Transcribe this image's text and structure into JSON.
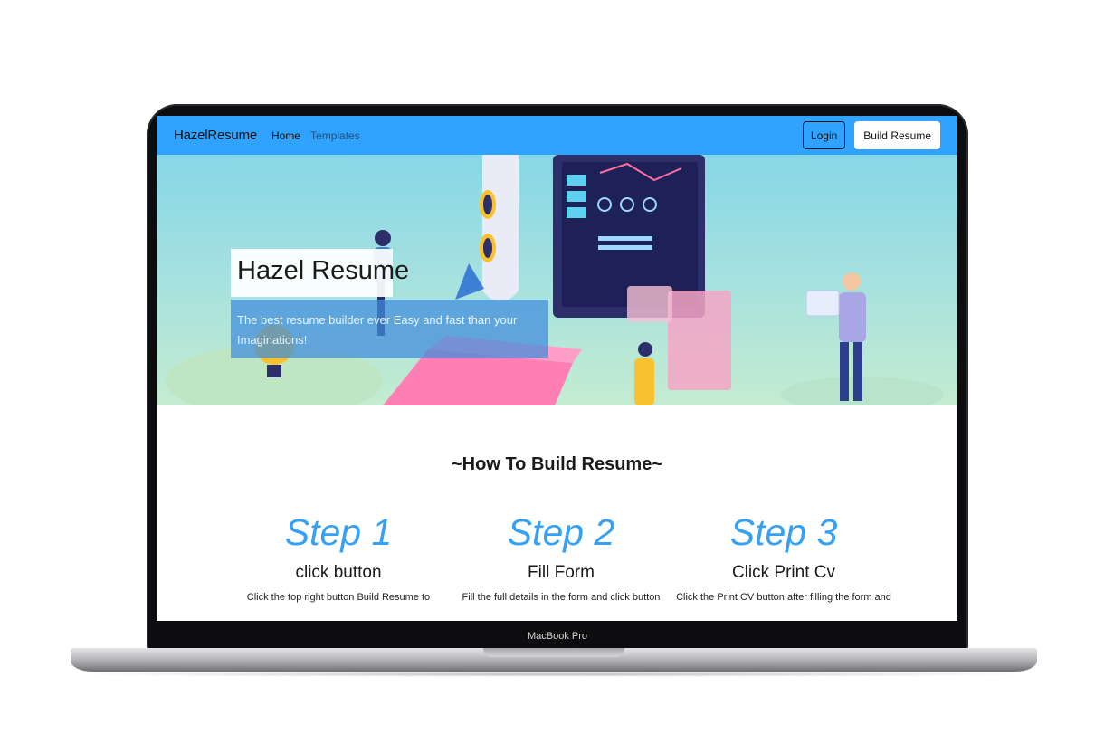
{
  "device": {
    "chin_label": "MacBook Pro"
  },
  "navbar": {
    "brand": "HazelResume",
    "links": [
      {
        "label": "Home"
      },
      {
        "label": "Templates"
      }
    ],
    "login_label": "Login",
    "build_label": "Build Resume"
  },
  "hero": {
    "title": "Hazel Resume",
    "subtitle": "The best resume builder ever Easy and fast than your Imaginations!"
  },
  "how_to": {
    "title": "~How To Build Resume~",
    "steps": [
      {
        "number": "Step 1",
        "heading": "click button",
        "description": "Click the top right button Build Resume to"
      },
      {
        "number": "Step 2",
        "heading": "Fill Form",
        "description": "Fill the full details in the form and click button"
      },
      {
        "number": "Step 3",
        "heading": "Click Print Cv",
        "description": "Click the Print CV button after filling the form and"
      }
    ]
  },
  "colors": {
    "navbar": "#2fa3ff",
    "accent": "#36a1f4",
    "hero_sub_bg": "#3f8cdc"
  }
}
